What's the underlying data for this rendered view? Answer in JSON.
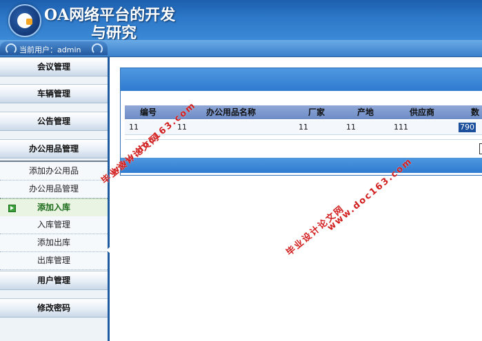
{
  "header": {
    "title_line1": "OA网络平台的开发",
    "title_line2": "与研究"
  },
  "userbar": {
    "label": "当前用户：admin"
  },
  "sidebar": {
    "menus": [
      {
        "label": "会议管理"
      },
      {
        "label": "车辆管理"
      },
      {
        "label": "公告管理"
      },
      {
        "label": "办公用品管理"
      }
    ],
    "sub_items": [
      {
        "label": "添加办公用品"
      },
      {
        "label": "办公用品管理"
      },
      {
        "label": "添加入库",
        "active": true
      },
      {
        "label": "入库管理"
      },
      {
        "label": "添加出库"
      },
      {
        "label": "出库管理"
      }
    ],
    "bottom_menus": [
      {
        "label": "用户管理"
      },
      {
        "label": "修改密码"
      }
    ]
  },
  "table": {
    "headers": [
      "编号",
      "办公用品名称",
      "厂家",
      "产地",
      "供应商",
      "数"
    ],
    "rows": [
      [
        "11",
        "11",
        "11",
        "11",
        "111",
        "790"
      ]
    ]
  },
  "watermark": {
    "line1": "毕业设计论文网",
    "line2": "www.doc163.com"
  },
  "colors": {
    "header_blue": "#2d78c8",
    "panel_blue": "#2f7bd0",
    "active_green": "#1a6a1a",
    "watermark_red": "#d21e1e"
  }
}
